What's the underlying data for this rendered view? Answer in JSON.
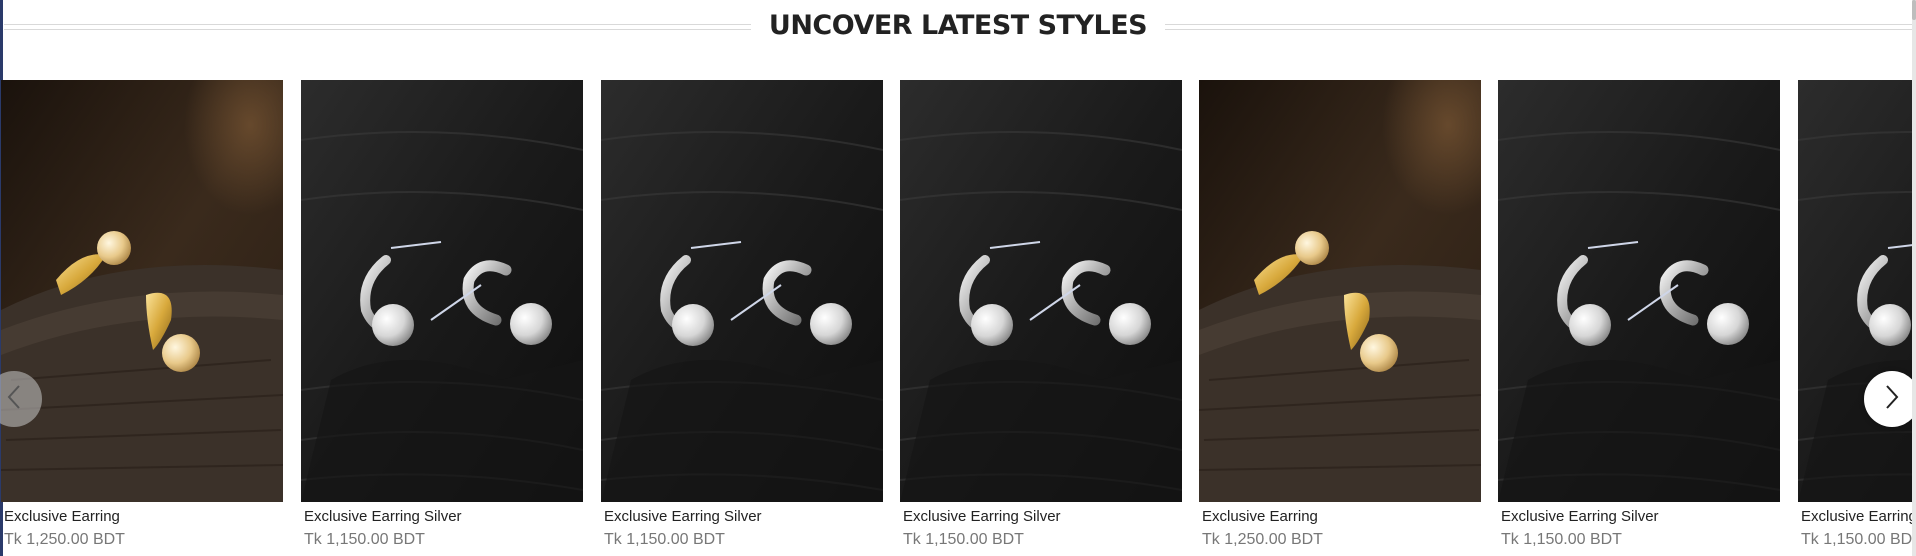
{
  "section": {
    "title": "UNCOVER LATEST STYLES"
  },
  "carousel": {
    "prev_icon": "chevron-left-icon",
    "next_icon": "chevron-right-icon",
    "products": [
      {
        "name": "Exclusive Earring",
        "price": "Tk 1,250.00 BDT",
        "variant": "gold"
      },
      {
        "name": "Exclusive Earring Silver",
        "price": "Tk 1,150.00 BDT",
        "variant": "silver"
      },
      {
        "name": "Exclusive Earring Silver",
        "price": "Tk 1,150.00 BDT",
        "variant": "silver"
      },
      {
        "name": "Exclusive Earring Silver",
        "price": "Tk 1,150.00 BDT",
        "variant": "silver"
      },
      {
        "name": "Exclusive Earring",
        "price": "Tk 1,250.00 BDT",
        "variant": "gold"
      },
      {
        "name": "Exclusive Earring Silver",
        "price": "Tk 1,150.00 BDT",
        "variant": "silver"
      },
      {
        "name": "Exclusive Earring Silver",
        "price": "Tk 1,150.00 BDT",
        "variant": "silver"
      }
    ]
  },
  "colors": {
    "title": "#222222",
    "price": "#777777",
    "rule": "#d9d9d9"
  }
}
